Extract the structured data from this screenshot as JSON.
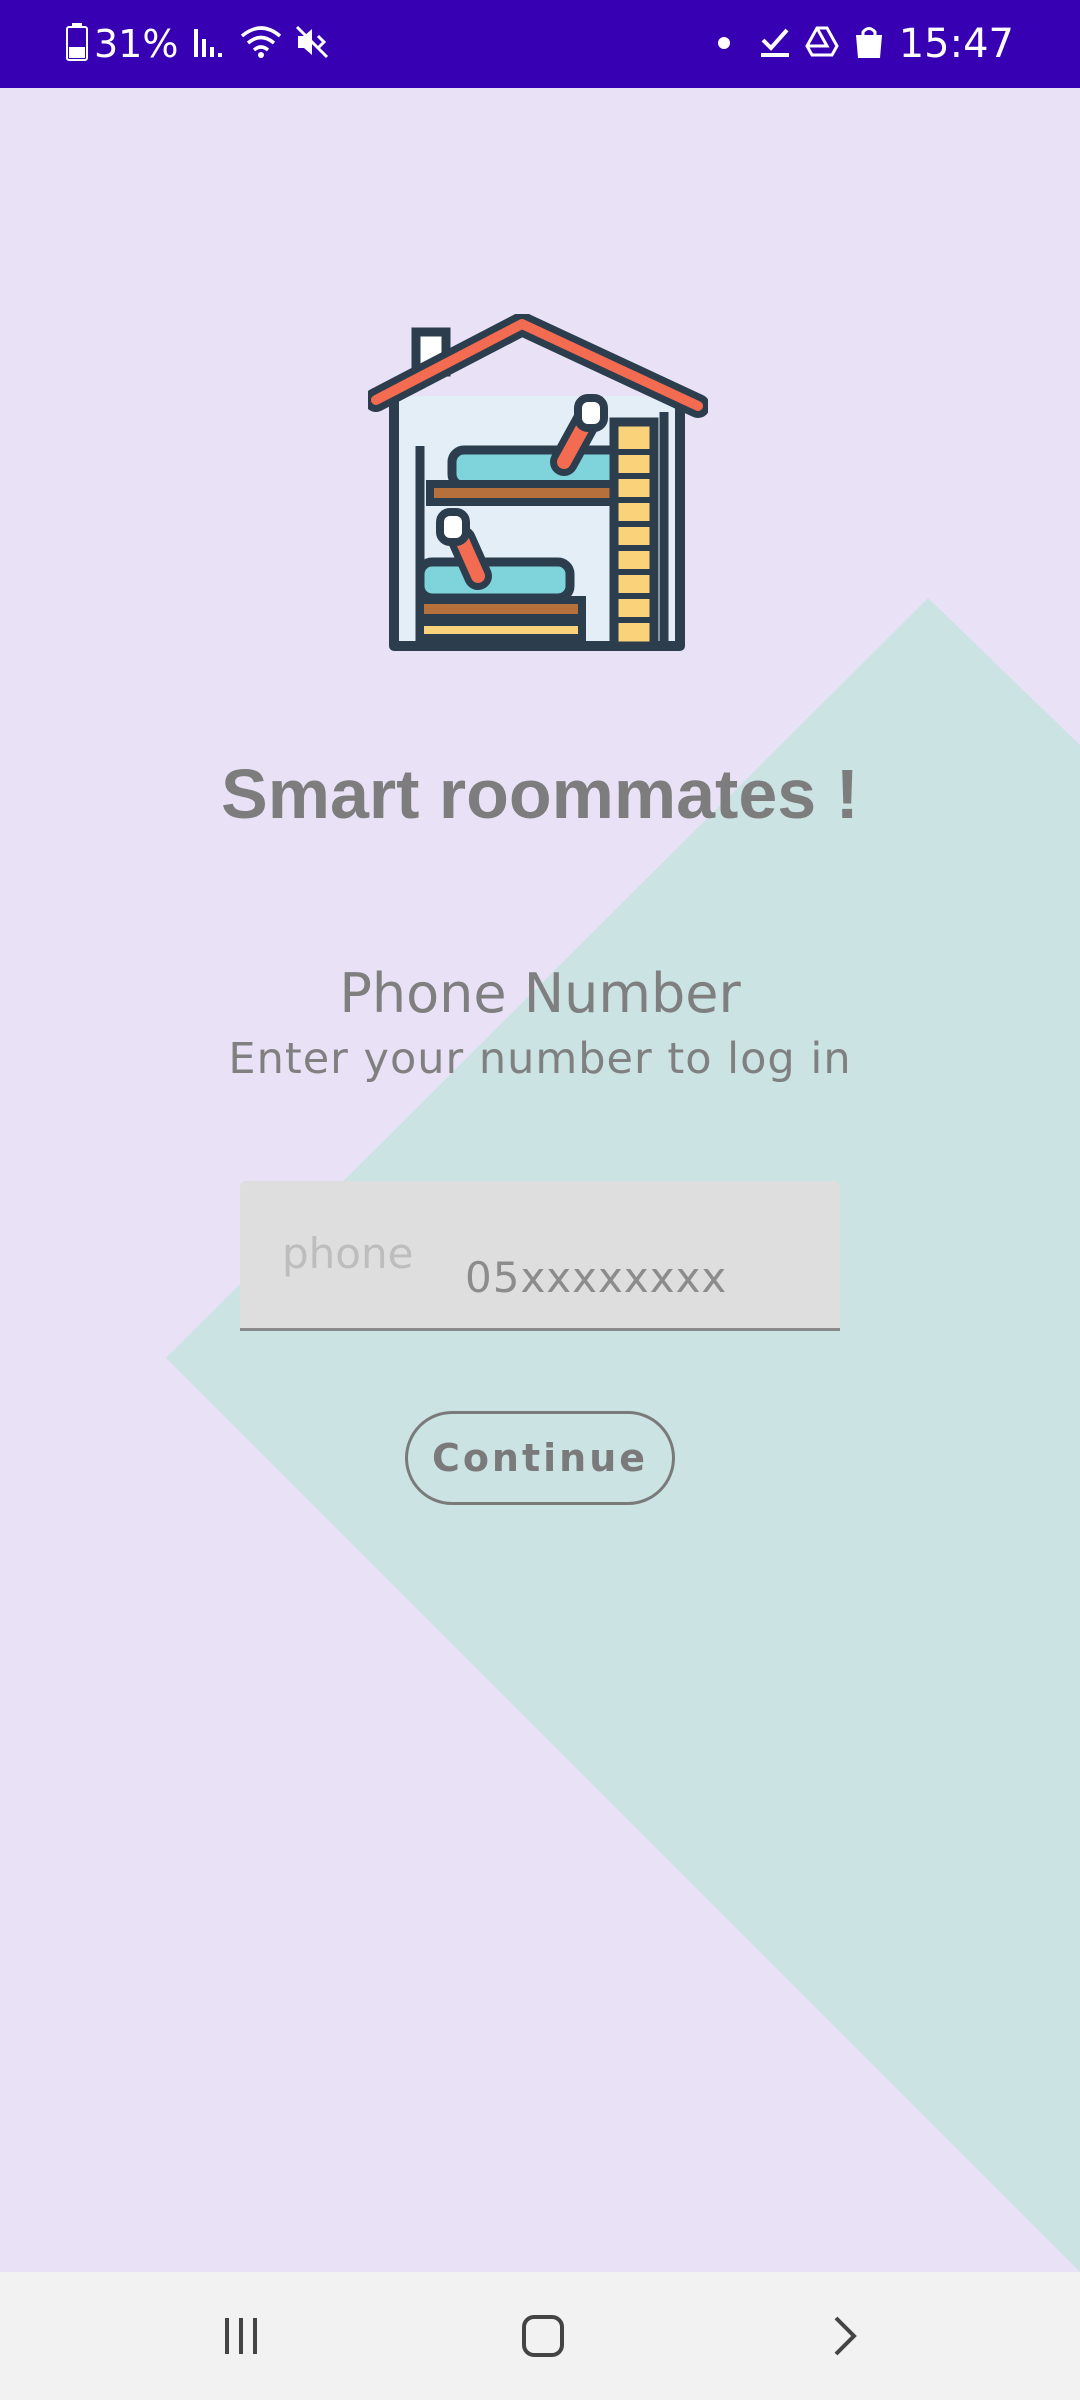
{
  "status_bar": {
    "battery": "31%",
    "time": "15:47",
    "icons_left": [
      "battery-icon",
      "signal-icon",
      "wifi-icon",
      "mute-icon"
    ],
    "icons_right": [
      "dot-icon",
      "task-check-icon",
      "drive-icon",
      "shopping-bag-icon"
    ]
  },
  "app": {
    "title": "Smart roommates !",
    "logo": "bunk-bed-house-icon"
  },
  "login": {
    "heading": "Phone Number",
    "subheading": "Enter your number to log in",
    "phone_label": "phone",
    "phone_placeholder": "05xxxxxxxx",
    "continue_label": "Continue"
  },
  "nav_bar": {
    "icons": [
      "recents-icon",
      "home-icon",
      "back-icon"
    ]
  },
  "colors": {
    "status_bar": "#3700b3",
    "background": "#e9e2f7",
    "diamond": "#cbe3e3",
    "text_gray": "#7d7d7d"
  }
}
